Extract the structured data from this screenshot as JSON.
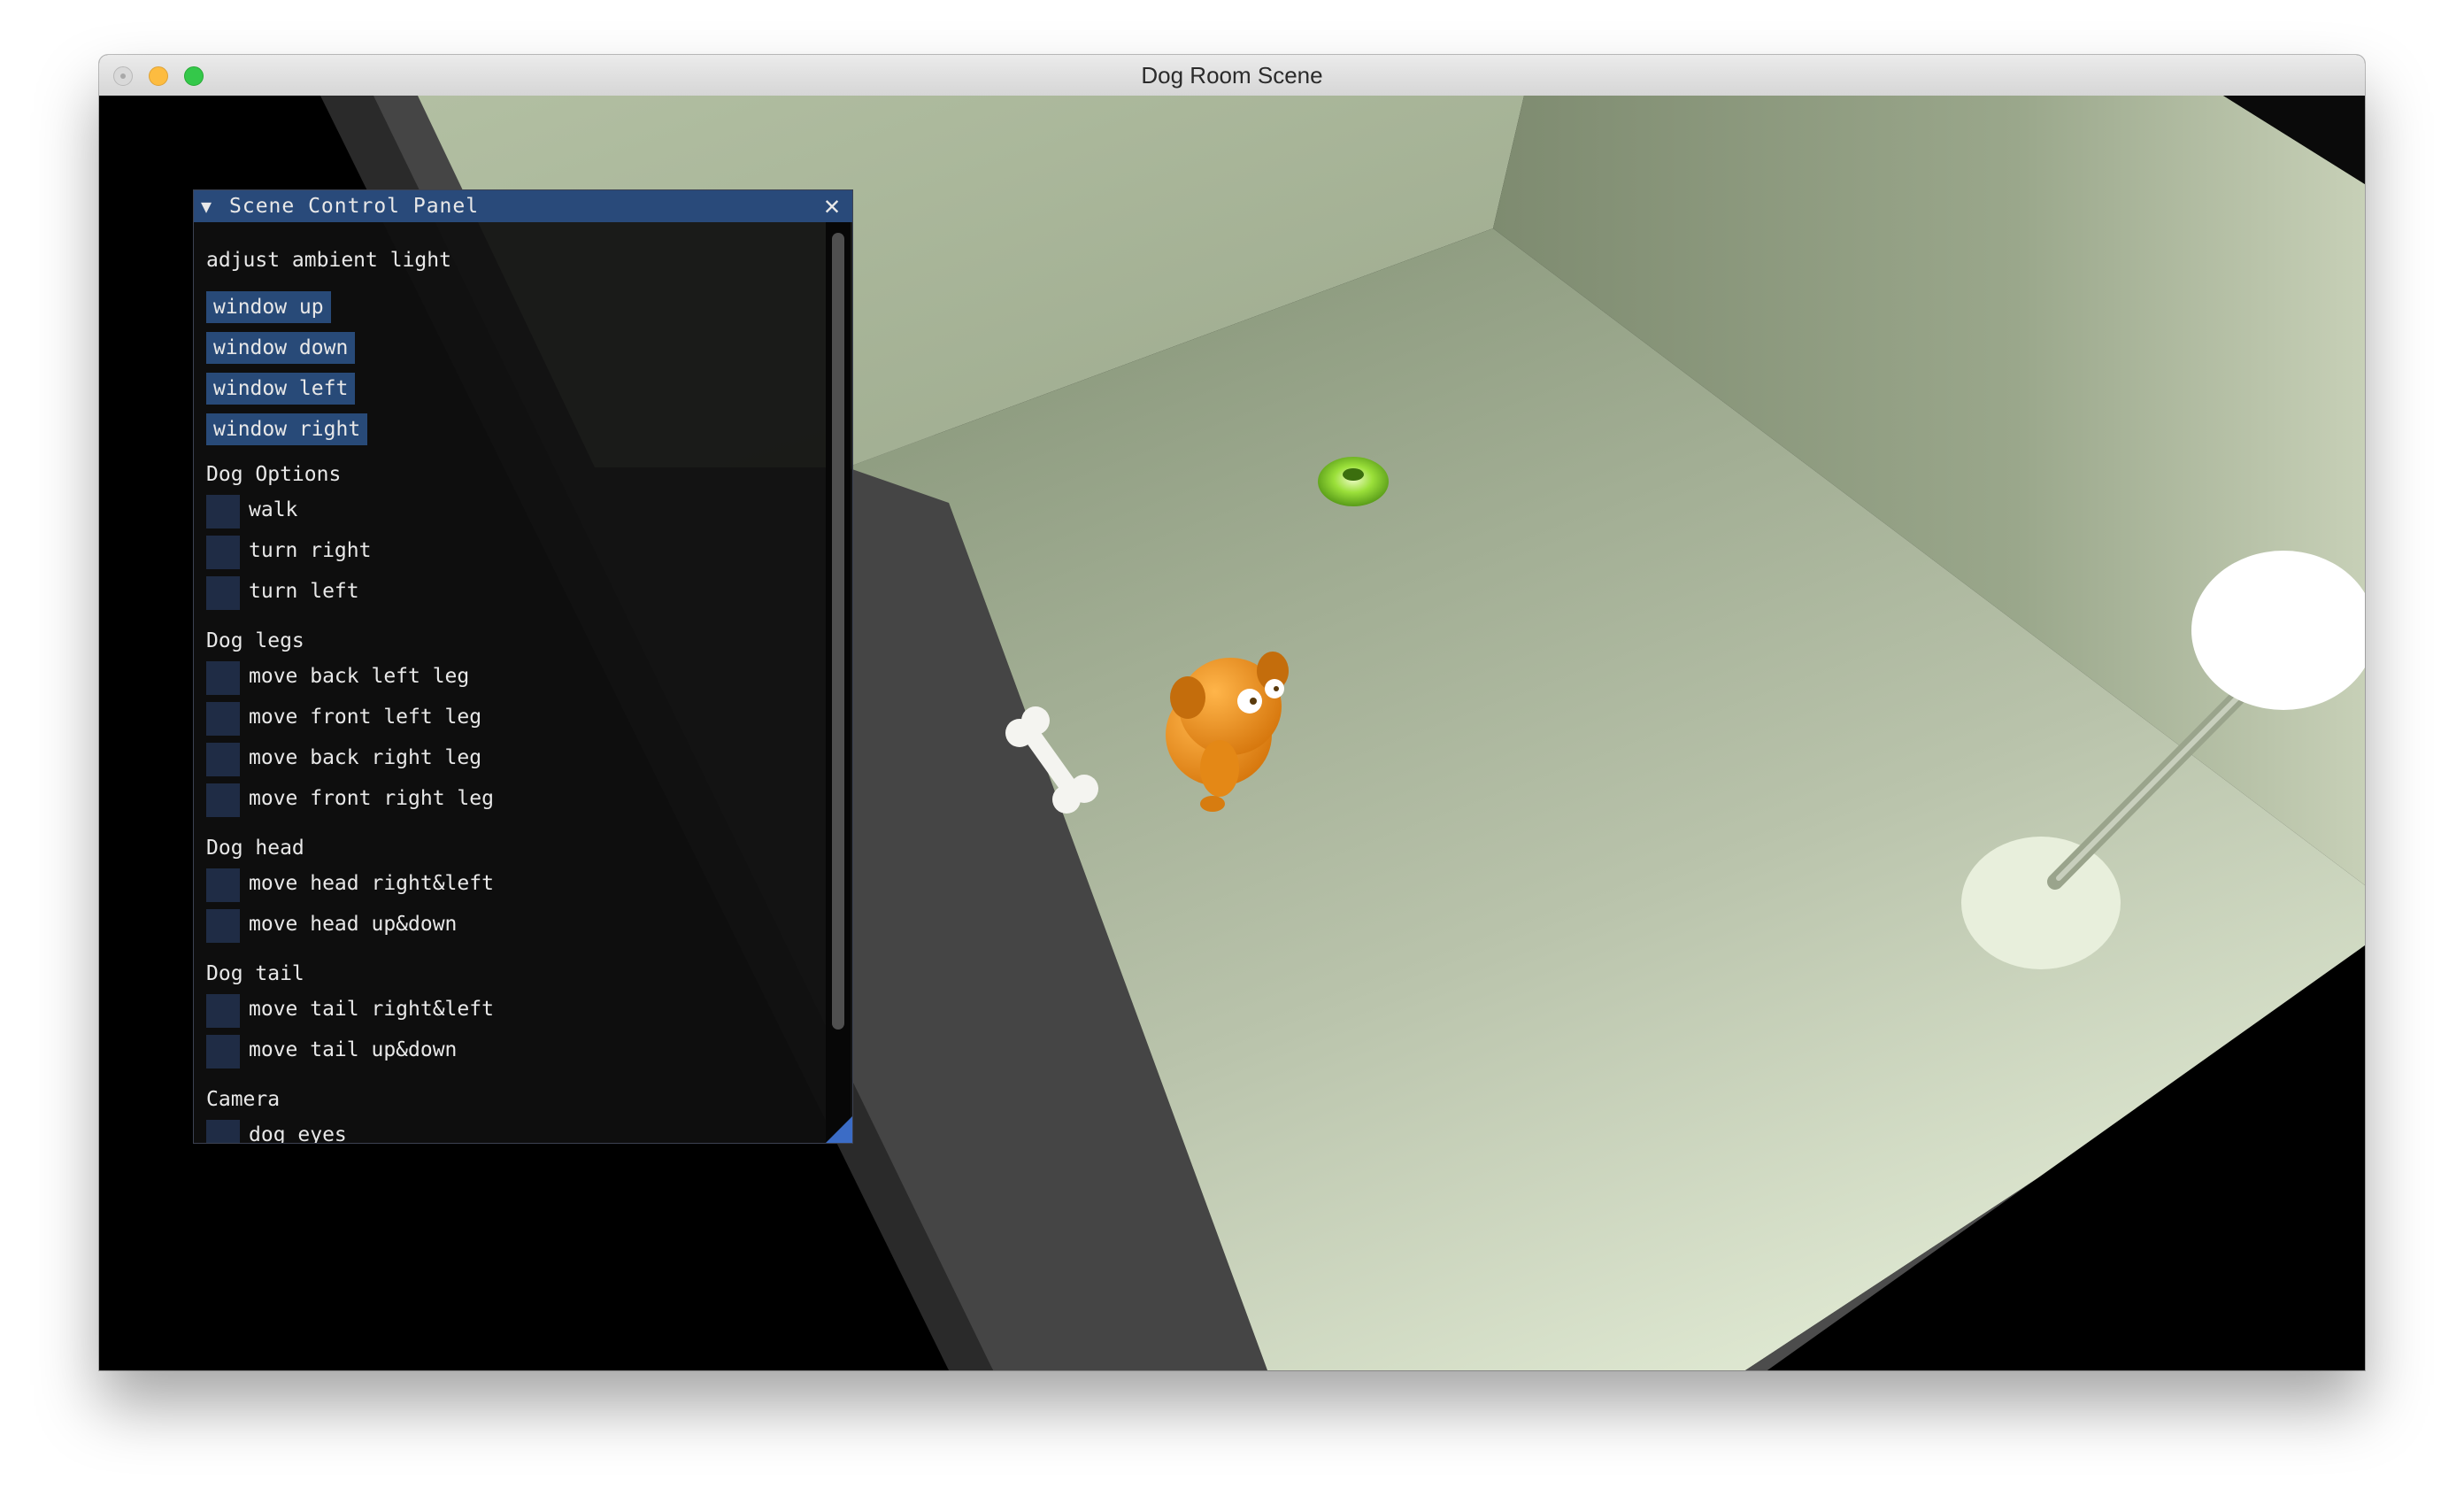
{
  "window": {
    "title": "Dog Room Scene"
  },
  "panel": {
    "title": "Scene Control Panel",
    "collapse_icon": "triangle-down-icon",
    "close_icon": "close-icon",
    "ambient_label": "adjust ambient light",
    "buttons": {
      "window_up": "window up",
      "window_down": "window down",
      "window_left": "window left",
      "window_right": "window right"
    },
    "dog_options": {
      "header": "Dog Options",
      "walk": "walk",
      "turn_right": "turn right",
      "turn_left": "turn left"
    },
    "dog_legs": {
      "header": "Dog legs",
      "back_left": "move back left leg",
      "front_left": "move front left leg",
      "back_right": "move back right leg",
      "front_right": "move front right leg"
    },
    "dog_head": {
      "header": "Dog head",
      "right_left": "move head right&left",
      "up_down": "move head up&down"
    },
    "dog_tail": {
      "header": "Dog tail",
      "right_left": "move tail right&left",
      "up_down": "move tail up&down"
    },
    "camera": {
      "header": "Camera",
      "dog_eyes": "dog eyes"
    }
  },
  "colors": {
    "panel_title_bg": "#294a7a",
    "button_bg": "#284a78",
    "checkbox_bg": "#1f2c45",
    "dog_color": "#f0901c",
    "green_object": "#7ed321"
  }
}
